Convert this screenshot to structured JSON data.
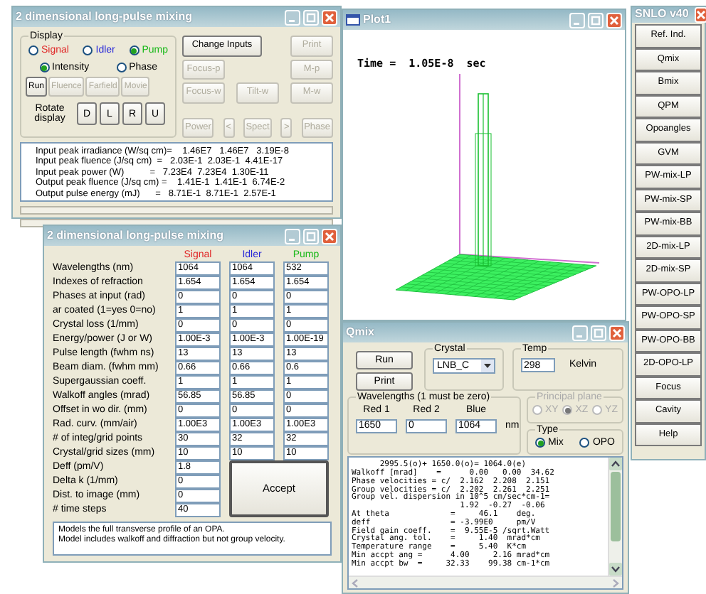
{
  "pulse_window": {
    "title": "2 dimensional long-pulse mixing",
    "display": {
      "legend": "Display",
      "beams": [
        {
          "label": "Signal",
          "color": "#e02828",
          "selected": false
        },
        {
          "label": "Idler",
          "color": "#2828d8",
          "selected": false
        },
        {
          "label": "Pump",
          "color": "#18b818",
          "selected": true
        }
      ],
      "modes": [
        {
          "label": "Intensity",
          "selected": true
        },
        {
          "label": "Phase",
          "selected": false
        }
      ],
      "actions": [
        {
          "label": "Run",
          "disabled": false
        },
        {
          "label": "Fluence",
          "disabled": true
        },
        {
          "label": "Farfield",
          "disabled": true
        },
        {
          "label": "Movie",
          "disabled": true
        }
      ],
      "rotate_label": "Rotate display",
      "rotate_buttons": [
        "D",
        "L",
        "R",
        "U"
      ]
    },
    "button_rows": [
      [
        {
          "label": "Change Inputs",
          "disabled": false
        },
        {
          "label": "Print",
          "disabled": true
        }
      ],
      [
        {
          "label": "Focus-p",
          "disabled": true
        },
        {
          "label": "M-p",
          "disabled": true
        }
      ],
      [
        {
          "label": "Focus-w",
          "disabled": true
        },
        {
          "label": "Tilt-w",
          "disabled": true
        },
        {
          "label": "M-w",
          "disabled": true
        }
      ],
      [
        {
          "label": "Power",
          "disabled": true
        },
        {
          "label": "<",
          "disabled": true
        },
        {
          "label": "Spect",
          "disabled": true
        },
        {
          "label": ">",
          "disabled": true
        },
        {
          "label": "Phase",
          "disabled": true
        }
      ]
    ],
    "output_lines": [
      "Input peak irradiance (W/sq cm)=    1.46E7   1.46E7   3.19E-8",
      "Input peak fluence (J/sq cm)  =   2.03E-1  2.03E-1  4.41E-17",
      "Input peak power (W)          =   7.23E4  7.23E4  1.30E-11",
      "Output peak fluence (J/sq cm) =    1.41E-1  1.41E-1  6.74E-2",
      "Output pulse energy (mJ)      =   8.71E-1  8.71E-1  2.57E-1"
    ]
  },
  "input_window": {
    "title": "2 dimensional long-pulse mixing",
    "columns": [
      {
        "label": "Signal",
        "color": "#e02828"
      },
      {
        "label": "Idler",
        "color": "#2828d8"
      },
      {
        "label": "Pump",
        "color": "#18b818"
      }
    ],
    "rows": [
      {
        "label": "Wavelengths (nm)",
        "values": [
          "1064",
          "1064",
          "532"
        ]
      },
      {
        "label": "Indexes of refraction",
        "values": [
          "1.654",
          "1.654",
          "1.654"
        ]
      },
      {
        "label": "Phases at input (rad)",
        "values": [
          "0",
          "0",
          "0"
        ]
      },
      {
        "label": "ar coated (1=yes 0=no)",
        "values": [
          "1",
          "1",
          "1"
        ]
      },
      {
        "label": "Crystal loss (1/mm)",
        "values": [
          "0",
          "0",
          "0"
        ]
      },
      {
        "label": "Energy/power (J or W)",
        "values": [
          "1.00E-3",
          "1.00E-3",
          "1.00E-19"
        ]
      },
      {
        "label": "Pulse length (fwhm ns)",
        "values": [
          "13",
          "13",
          "13"
        ]
      },
      {
        "label": "Beam diam. (fwhm mm)",
        "values": [
          "0.66",
          "0.66",
          "0.6"
        ]
      },
      {
        "label": "Supergaussian coeff.",
        "values": [
          "1",
          "1",
          "1"
        ]
      },
      {
        "label": "Walkoff angles (mrad)",
        "values": [
          "56.85",
          "56.85",
          "0"
        ]
      },
      {
        "label": "Offset in wo dir. (mm)",
        "values": [
          "0",
          "0",
          "0"
        ]
      },
      {
        "label": "Rad. curv. (mm/air)",
        "values": [
          "1.00E3",
          "1.00E3",
          "1.00E3"
        ]
      },
      {
        "label": "# of integ/grid points",
        "values": [
          "30",
          "32",
          "32"
        ]
      },
      {
        "label": "Crystal/grid sizes (mm)",
        "values": [
          "10",
          "10",
          "10"
        ]
      },
      {
        "label": "Deff (pm/V)",
        "values": [
          "1.8"
        ]
      },
      {
        "label": "Delta k (1/mm)",
        "values": [
          "0"
        ]
      },
      {
        "label": "Dist. to image (mm)",
        "values": [
          "0"
        ]
      },
      {
        "label": "# time steps",
        "values": [
          "40"
        ]
      }
    ],
    "accept": "Accept",
    "notes": [
      "Models the full transverse profile of an OPA.",
      "Model includes walkoff and diffraction but not group velocity."
    ]
  },
  "plot_window": {
    "title": "Plot1",
    "time_text": "Time =  1.05E-8  sec"
  },
  "qmix_window": {
    "title": "Qmix",
    "buttons": [
      "Run",
      "Print"
    ],
    "crystal": {
      "legend": "Crystal",
      "value": "LNB_C"
    },
    "temp": {
      "legend": "Temp",
      "value": "298",
      "unit": "Kelvin"
    },
    "wavelengths": {
      "legend": "Wavelengths (1 must be zero)",
      "fields": [
        {
          "label": "Red 1",
          "value": "1650"
        },
        {
          "label": "Red 2",
          "value": "0"
        },
        {
          "label": "Blue",
          "value": "1064"
        }
      ],
      "unit": "nm"
    },
    "principal_plane": {
      "legend": "Principal plane",
      "disabled": true,
      "options": [
        {
          "label": "XY",
          "selected": false
        },
        {
          "label": "XZ",
          "selected": true
        },
        {
          "label": "YZ",
          "selected": false
        }
      ]
    },
    "type": {
      "legend": "Type",
      "options": [
        {
          "label": "Mix",
          "selected": true
        },
        {
          "label": "OPO",
          "selected": false
        }
      ]
    },
    "output_lines": [
      "      2995.5(o)+ 1650.0(o)= 1064.0(e)",
      "Walkoff [mrad]    =      0.00   0.00  34.62",
      "Phase velocities = c/  2.162  2.208  2.151",
      "Group velocities = c/  2.202  2.261  2.251",
      "Group vel. dispersion in 10^5 cm/sec*cm-1=",
      "                       1.92  -0.27  -0.06",
      "At theta             =     46.1    deg.",
      "deff                 = -3.99E0     pm/V",
      "Field gain coeff.    =  9.55E-5 /sqrt.Watt",
      "Crystal ang. tol.    =     1.40  mrad*cm",
      "Temperature range    =     5.40  K*cm",
      "Min accpt ang =      4.00     2.16 mrad*cm",
      "Min accpt bw  =     32.33    99.38 cm-1*cm"
    ]
  },
  "snlo_window": {
    "title": "SNLO v40",
    "buttons": [
      "Ref. Ind.",
      "Qmix",
      "Bmix",
      "QPM",
      "Opoangles",
      "GVM",
      "PW-mix-LP",
      "PW-mix-SP",
      "PW-mix-BB",
      "2D-mix-LP",
      "2D-mix-SP",
      "PW-OPO-LP",
      "PW-OPO-SP",
      "PW-OPO-BB",
      "2D-OPO-LP",
      "Focus",
      "Cavity",
      "Help"
    ]
  }
}
